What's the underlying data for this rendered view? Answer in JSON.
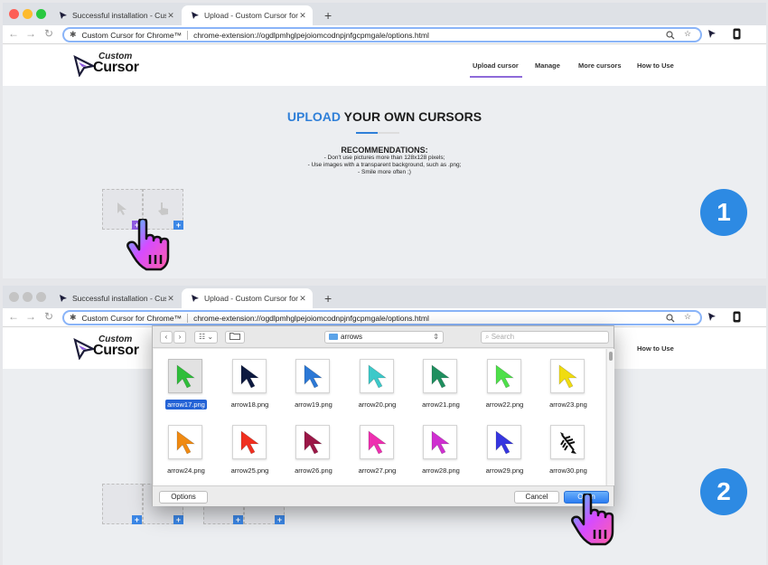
{
  "browser": {
    "tab1_title": "Successful installation - Custom",
    "tab2_title": "Upload - Custom Cursor for Chro",
    "tab_close": "✕",
    "new_tab": "+",
    "back": "←",
    "forward": "→",
    "reload": "↻",
    "site_chip": "Custom Cursor for Chrome™",
    "url": "chrome-extension://ogdlpmhglpejoiomcodnpjnfgcpmgale/options.html"
  },
  "site": {
    "logo_small": "Custom",
    "logo_big": "Cursor",
    "nav": [
      "Upload cursor",
      "Manage",
      "More cursors",
      "How to Use"
    ],
    "heading_highlight": "UPLOAD",
    "heading_rest": " YOUR OWN CURSORS",
    "rec_title": "RECOMMENDATIONS:",
    "rec_lines": [
      "- Don't use pictures more than 128x128 pixels;",
      "- Use images with a transparent background, such as .png;",
      "- Smile more often ;)"
    ],
    "plus": "+"
  },
  "steps": [
    "1",
    "2"
  ],
  "dialog": {
    "location": "arrows",
    "search_placeholder": "Search",
    "nav_back": "‹",
    "nav_forward": "›",
    "view_label": "☷ ⌄",
    "files": [
      {
        "name": "arrow17.png",
        "color": "#2fbe3a",
        "selected": true
      },
      {
        "name": "arrow18.png",
        "color": "#0d1a40"
      },
      {
        "name": "arrow19.png",
        "color": "#2b78d6"
      },
      {
        "name": "arrow20.png",
        "color": "#3cc9c9"
      },
      {
        "name": "arrow21.png",
        "color": "#1f8f5f"
      },
      {
        "name": "arrow22.png",
        "color": "#4ee04a"
      },
      {
        "name": "arrow23.png",
        "color": "#f0dc10"
      },
      {
        "name": "arrow24.png",
        "color": "#f08a12"
      },
      {
        "name": "arrow25.png",
        "color": "#f02f1f"
      },
      {
        "name": "arrow26.png",
        "color": "#9b1747"
      },
      {
        "name": "arrow27.png",
        "color": "#ee2fb0"
      },
      {
        "name": "arrow28.png",
        "color": "#cf2fd0"
      },
      {
        "name": "arrow29.png",
        "color": "#3636e0"
      },
      {
        "name": "arrow30.png",
        "color": "#111111",
        "icon": "fishbone-icon"
      }
    ],
    "options_label": "Options",
    "cancel_label": "Cancel",
    "open_label": "Open"
  }
}
